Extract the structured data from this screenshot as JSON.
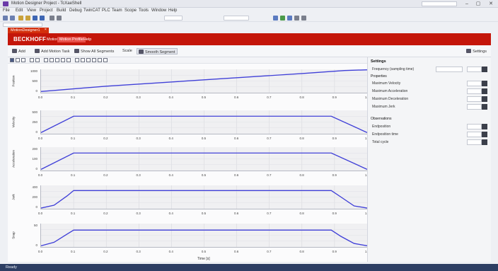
{
  "window": {
    "title": "Motion Designer Project - TcXaeShell",
    "search_placeholder": "",
    "controls": [
      "–",
      "▢",
      "✕"
    ]
  },
  "menu": [
    "File",
    "Edit",
    "View",
    "Project",
    "Build",
    "Debug",
    "TwinCAT",
    "PLC",
    "Team",
    "Scope",
    "Tools",
    "Window",
    "Help"
  ],
  "document_tab": {
    "label": "MotionDesigner1",
    "close": "×"
  },
  "brand": {
    "logo": "BECKHOFF",
    "tabs": [
      {
        "label": "Motion",
        "active": false
      },
      {
        "label": "Motion Profile",
        "active": true
      },
      {
        "label": "Help",
        "active": false
      }
    ]
  },
  "ribbon": {
    "buttons": [
      "Add",
      "Add Motion Task",
      "Show All Segments",
      "Scale",
      "Smooth Segment"
    ],
    "settings_label": "Settings"
  },
  "charts": [
    {
      "ylabel": "Position",
      "yticks": [
        "1000",
        "500",
        "0"
      ]
    },
    {
      "ylabel": "Velocity",
      "yticks": [
        "500",
        "250",
        "0"
      ]
    },
    {
      "ylabel": "Acceleration",
      "yticks": [
        "200",
        "100",
        "0"
      ]
    },
    {
      "ylabel": "Jerk",
      "yticks": [
        "400",
        "200",
        "0"
      ]
    },
    {
      "ylabel": "Snap",
      "yticks": [
        "50",
        "0"
      ]
    }
  ],
  "xticks": [
    "0.0",
    "0.1",
    "0.2",
    "0.3",
    "0.4",
    "0.5",
    "0.6",
    "0.7",
    "0.8",
    "0.9",
    "1.0"
  ],
  "x_axis_label": "Time [s]",
  "settings": {
    "title": "Settings",
    "rows_top": [
      {
        "label": "Frequency (sampling time)",
        "value": "",
        "unit": ""
      }
    ],
    "section_properties": "Properties",
    "rows_props": [
      {
        "label": "Maximum Velocity",
        "value": "",
        "unit": ""
      },
      {
        "label": "Maximum Acceleration",
        "value": "",
        "unit": ""
      },
      {
        "label": "Maximum Deceleration",
        "value": "",
        "unit": ""
      },
      {
        "label": "Maximum Jerk",
        "value": "",
        "unit": ""
      }
    ],
    "section_observations": "Observations",
    "rows_obs": [
      {
        "label": "Endposition",
        "value": "",
        "unit": ""
      },
      {
        "label": "Endposition time",
        "value": "",
        "unit": ""
      },
      {
        "label": "Total cycle",
        "value": "",
        "unit": ""
      }
    ]
  },
  "status": {
    "text": "Ready"
  },
  "colors": {
    "brand_red": "#c4160a",
    "curve": "#4040d8",
    "status_bar": "#2d3e63"
  }
}
